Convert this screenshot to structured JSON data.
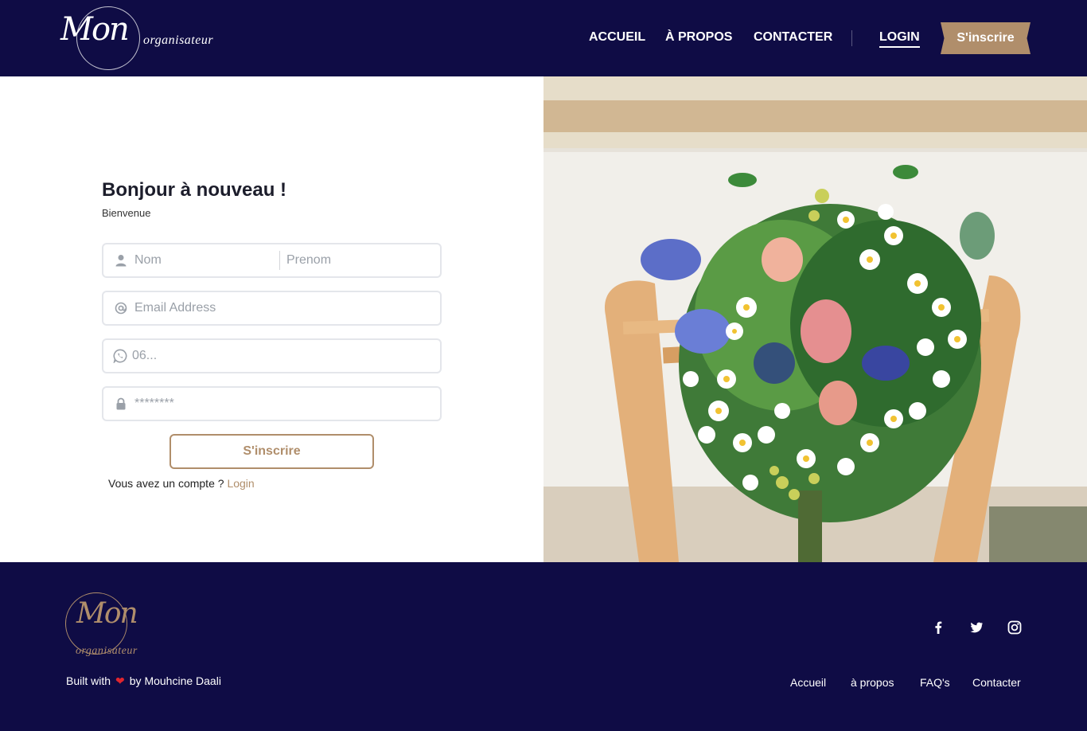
{
  "brand": {
    "script": "Mon",
    "word": "organisateur"
  },
  "nav": {
    "items": [
      {
        "label": "ACCUEIL"
      },
      {
        "label": "À PROPOS"
      },
      {
        "label": "CONTACTER"
      },
      {
        "label": "LOGIN"
      }
    ],
    "cta_label": "S'inscrire"
  },
  "form": {
    "title": "Bonjour à nouveau !",
    "subtitle": "Bienvenue",
    "nom_placeholder": "Nom",
    "prenom_placeholder": "Prenom",
    "email_placeholder": "Email Address",
    "phone_placeholder": "06...",
    "password_placeholder": "********",
    "submit_label": "S'inscrire",
    "has_account_text": "Vous avez un compte ?",
    "login_link": "Login"
  },
  "footer": {
    "built_with": "Built with",
    "built_by": "by Mouhcine Daali",
    "links": [
      {
        "label": "Accueil"
      },
      {
        "label": "à propos"
      },
      {
        "label": "FAQ's"
      },
      {
        "label": "Contacter"
      }
    ],
    "social": [
      "facebook-icon",
      "twitter-icon",
      "instagram-icon"
    ]
  },
  "colors": {
    "navy": "#0f0c45",
    "accent": "#b08e6b",
    "heart": "#e0252e"
  }
}
